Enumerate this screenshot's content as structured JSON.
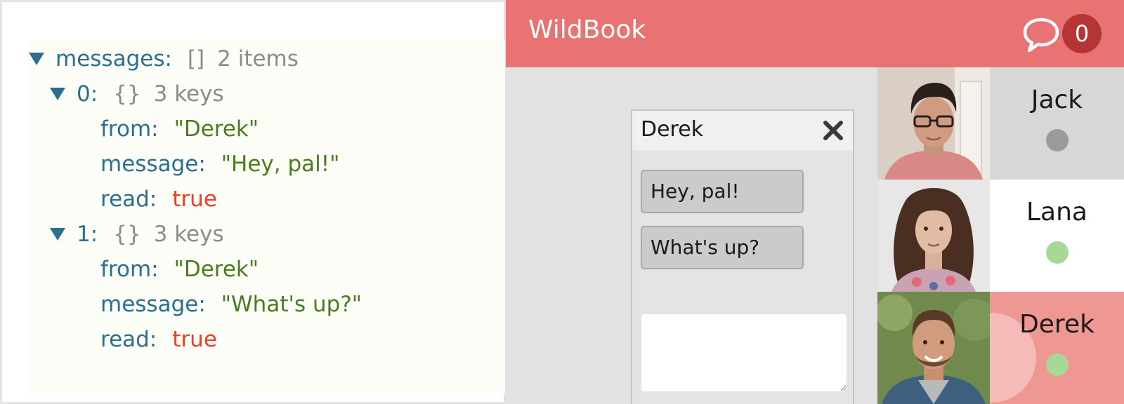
{
  "inspector": {
    "rows": [
      {
        "key": "messages:",
        "bracket": "[]",
        "meta": "2 items"
      },
      {
        "key": "0:",
        "bracket": "{}",
        "meta": "3 keys"
      },
      {
        "key": "from:",
        "value": "\"Derek\""
      },
      {
        "key": "message:",
        "value": "\"Hey, pal!\""
      },
      {
        "key": "read:",
        "value": "true"
      },
      {
        "key": "1:",
        "bracket": "{}",
        "meta": "3 keys"
      },
      {
        "key": "from:",
        "value": "\"Derek\""
      },
      {
        "key": "message:",
        "value": "\"What's up?\""
      },
      {
        "key": "read:",
        "value": "true"
      }
    ]
  },
  "app": {
    "title": "WildBook",
    "unread_count": "0",
    "chat": {
      "name": "Derek",
      "messages": [
        "Hey, pal!",
        "What's up?"
      ],
      "input_value": ""
    },
    "contacts": [
      {
        "name": "Jack",
        "status": "offline",
        "status_color": "#9b9b9b",
        "bg": "#d7d7d7"
      },
      {
        "name": "Lana",
        "status": "online",
        "status_color": "#a6d997",
        "bg": "#ffffff"
      },
      {
        "name": "Derek",
        "status": "online",
        "status_color": "#a6d997",
        "bg": "#ee9793"
      }
    ]
  },
  "colors": {
    "appbar": "#e87372",
    "badge": "#b53535",
    "key": "#2b6f8e",
    "string": "#4c7b1d",
    "boolean": "#e5432b",
    "online": "#a6d997",
    "offline": "#9b9b9b",
    "active_contact": "#ee9793"
  },
  "icons": {
    "tree_toggle": "triangle-down-icon",
    "chat": "speech-bubble-icon",
    "close": "close-icon"
  }
}
